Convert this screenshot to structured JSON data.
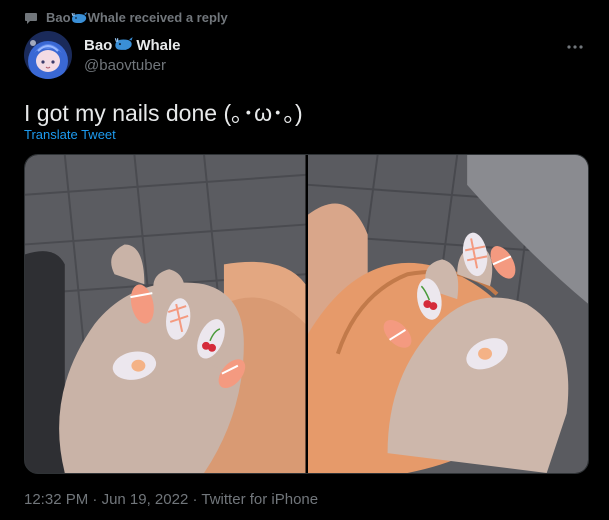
{
  "context": {
    "name": "Bao",
    "suffix": "Whale received a reply",
    "icon": "speech-bubble-icon"
  },
  "author": {
    "name_part1": "Bao",
    "name_part2": "Whale",
    "handle": "@baovtuber",
    "emoji": "whale-icon"
  },
  "tweet": {
    "text": "I got my nails done (｡･ω･｡)",
    "translate_label": "Translate Tweet"
  },
  "media": {
    "count": 2,
    "subjects": [
      "hand-with-nails-photo",
      "hand-with-nails-photo"
    ]
  },
  "meta": {
    "time": "12:32 PM",
    "date": "Jun 19, 2022",
    "source": "Twitter for iPhone",
    "separator": "·"
  },
  "colors": {
    "background": "#000000",
    "text": "#e7e9ea",
    "secondary": "#71767b",
    "link": "#1d9bf0",
    "nail_peach": "#f49a80",
    "nail_white": "#ece7ee"
  }
}
